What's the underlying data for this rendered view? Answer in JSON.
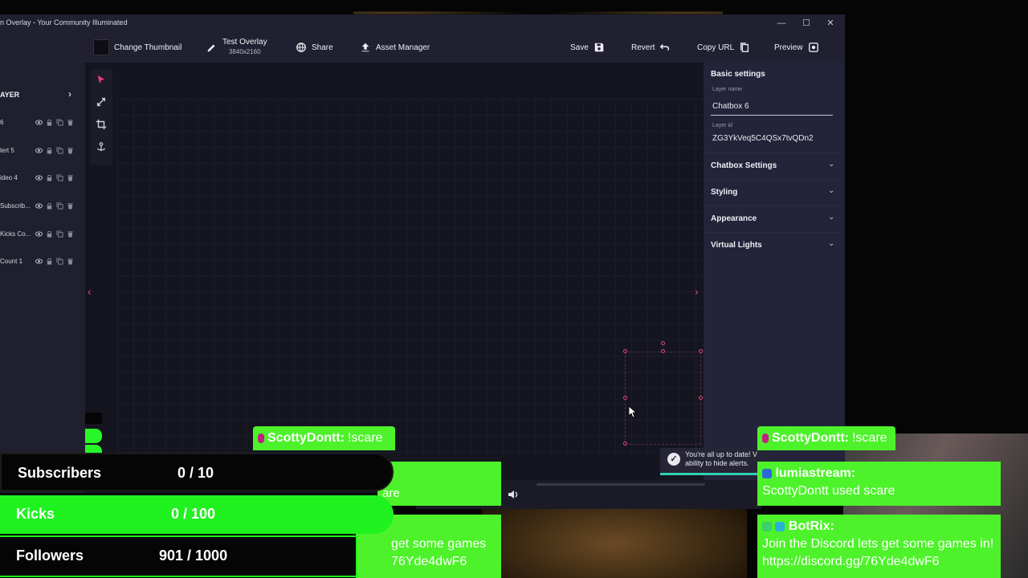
{
  "window": {
    "title": "n Overlay - Your Community Illuminated",
    "controls": {
      "minimize": "—",
      "maximize": "☐",
      "close": "✕"
    }
  },
  "toolbar": {
    "change_thumbnail": "Change Thumbnail",
    "overlay_name": "Test Overlay",
    "overlay_resolution": "3840x2160",
    "share": "Share",
    "asset_manager": "Asset Manager",
    "save": "Save",
    "revert": "Revert",
    "copy_url": "Copy URL",
    "preview": "Preview"
  },
  "layers": {
    "header": "AYER",
    "items": [
      {
        "label": "6"
      },
      {
        "label": "lert 5"
      },
      {
        "label": "ideo 4"
      },
      {
        "label": "Subscrib..."
      },
      {
        "label": "Kicks Co..."
      },
      {
        "label": "Count 1"
      }
    ]
  },
  "settings": {
    "basic_title": "Basic settings",
    "layer_name_label": "Layer name",
    "layer_name_value": "Chatbox 6",
    "layer_id_label": "Layer id",
    "layer_id_value": "ZG3YkVeq5C4QSx7tvQDn2",
    "sections": [
      "Chatbox Settings",
      "Styling",
      "Appearance",
      "Virtual Lights"
    ]
  },
  "toast": {
    "line1": "You're all up to date! V",
    "line2": "ability to hide alerts."
  },
  "goals": [
    {
      "label": "Subscribers",
      "value": "0 / 10",
      "bg": "#050505",
      "fg": "#ffffff"
    },
    {
      "label": "Kicks",
      "value": "0 / 100",
      "bg": "#1ff21f",
      "fg": "#ffffff"
    },
    {
      "label": "Followers",
      "value": "901 / 1000",
      "bg": "#050505",
      "fg": "#ffffff"
    }
  ],
  "goal_progress": {
    "subscribers": 0,
    "kicks": 0,
    "followers": 0.901
  },
  "chat_left": {
    "header_user": "ScottyDontt:",
    "header_msg": "!scare",
    "box1_text": "are",
    "box2_line1": "get some games",
    "box2_line2": "76Yde4dwF6"
  },
  "chat_right": {
    "header_user": "ScottyDontt:",
    "header_msg": "!scare",
    "msg1_author": "lumiastream:",
    "msg1_text": "ScottyDontt used scare",
    "msg2_author": "BotRix:",
    "msg2_text": "Join the Discord lets get some games in! https://discord.gg/76Yde4dwF6"
  },
  "colors": {
    "accent": "#e8407a",
    "chat_green": "#4df22a",
    "kicks_green": "#1ff21f",
    "panel": "#23233a",
    "canvas": "#15151f"
  }
}
